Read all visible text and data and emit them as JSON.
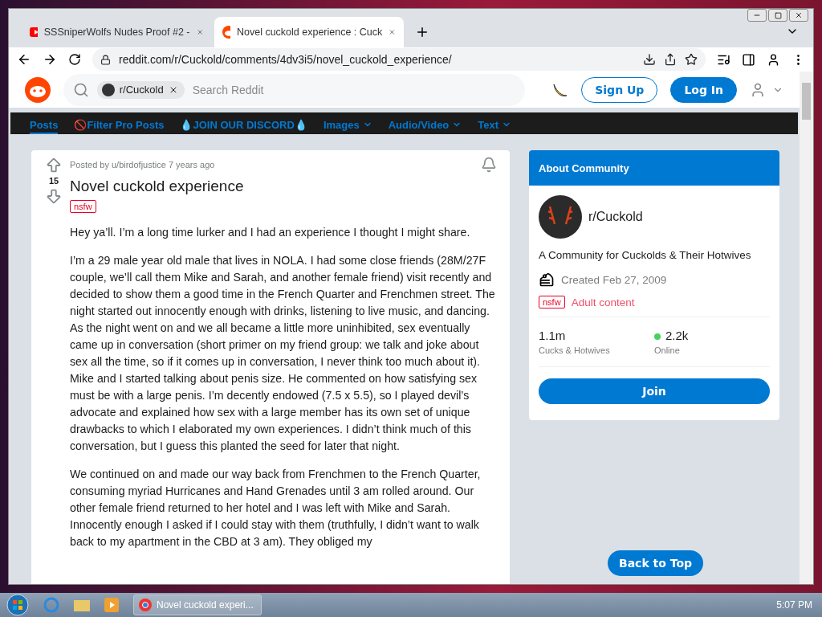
{
  "tabs": [
    {
      "title": "SSSniperWolfs Nudes Proof #2 -",
      "kind": "youtube",
      "selected": false
    },
    {
      "title": "Novel cuckold experience : Cuck",
      "kind": "reddit",
      "selected": true
    }
  ],
  "address": "reddit.com/r/Cuckold/comments/4dv3i5/novel_cuckold_experience/",
  "header": {
    "community_chip": "r/Cuckold",
    "search_placeholder": "Search Reddit",
    "sign_up": "Sign Up",
    "log_in": "Log In"
  },
  "nav": [
    {
      "label": "Posts",
      "selected": true,
      "dropdown": false
    },
    {
      "label": "🚫Filter Pro Posts",
      "selected": false,
      "dropdown": false
    },
    {
      "label": "💧JOIN OUR DISCORD💧",
      "selected": false,
      "dropdown": false
    },
    {
      "label": "Images",
      "selected": false,
      "dropdown": true
    },
    {
      "label": "Audio/Video",
      "selected": false,
      "dropdown": true
    },
    {
      "label": "Text",
      "selected": false,
      "dropdown": true
    }
  ],
  "post": {
    "votes": "15",
    "meta": "Posted by u/birdofjustice 7 years ago",
    "title": "Novel cuckold experience",
    "flair": "nsfw",
    "paragraphs": [
      "Hey ya’ll. I’m a long time lurker and I had an experience I thought I might share.",
      "I’m a 29 male year old male that lives in NOLA. I had some close friends (28M/27F couple, we’ll call them Mike and Sarah, and another female friend) visit recently and decided to show them a good time in the French Quarter and Frenchmen street. The night started out innocently enough with drinks, listening to live music, and dancing. As the night went on and we all became a little more uninhibited, sex eventually came up in conversation (short primer on my friend group: we talk and joke about sex all the time, so if it comes up in conversation, I never think too much about it). Mike and I started talking about penis size. He commented on how satisfying sex must be with a large penis. I’m decently endowed (7.5 x 5.5), so I played devil’s advocate and explained how sex with a large member has its own set of unique drawbacks to which I elaborated my own experiences. I didn’t think much of this conversation, but I guess this planted the seed for later that night.",
      "We continued on and made our way back from Frenchmen to the French Quarter, consuming myriad Hurricanes and Hand Grenades until 3 am rolled around. Our other female friend returned to her hotel and I was left with Mike and Sarah. Innocently enough I asked if I could stay with them (truthfully, I didn’t want to walk back to my apartment in the CBD at 3 am). They obliged my"
    ]
  },
  "about": {
    "heading": "About Community",
    "name": "r/Cuckold",
    "description": "A Community for Cuckolds & Their Hotwives",
    "created": "Created Feb 27, 2009",
    "flair": "nsfw",
    "flair_text": "Adult content",
    "stats": [
      {
        "value": "1.1m",
        "label": "Cucks & Hotwives",
        "online": false
      },
      {
        "value": "2.2k",
        "label": "Online",
        "online": true
      }
    ],
    "join": "Join"
  },
  "back_to_top": "Back to Top",
  "taskbar": {
    "window": "Novel cuckold experi...",
    "clock": "5:07 PM"
  }
}
